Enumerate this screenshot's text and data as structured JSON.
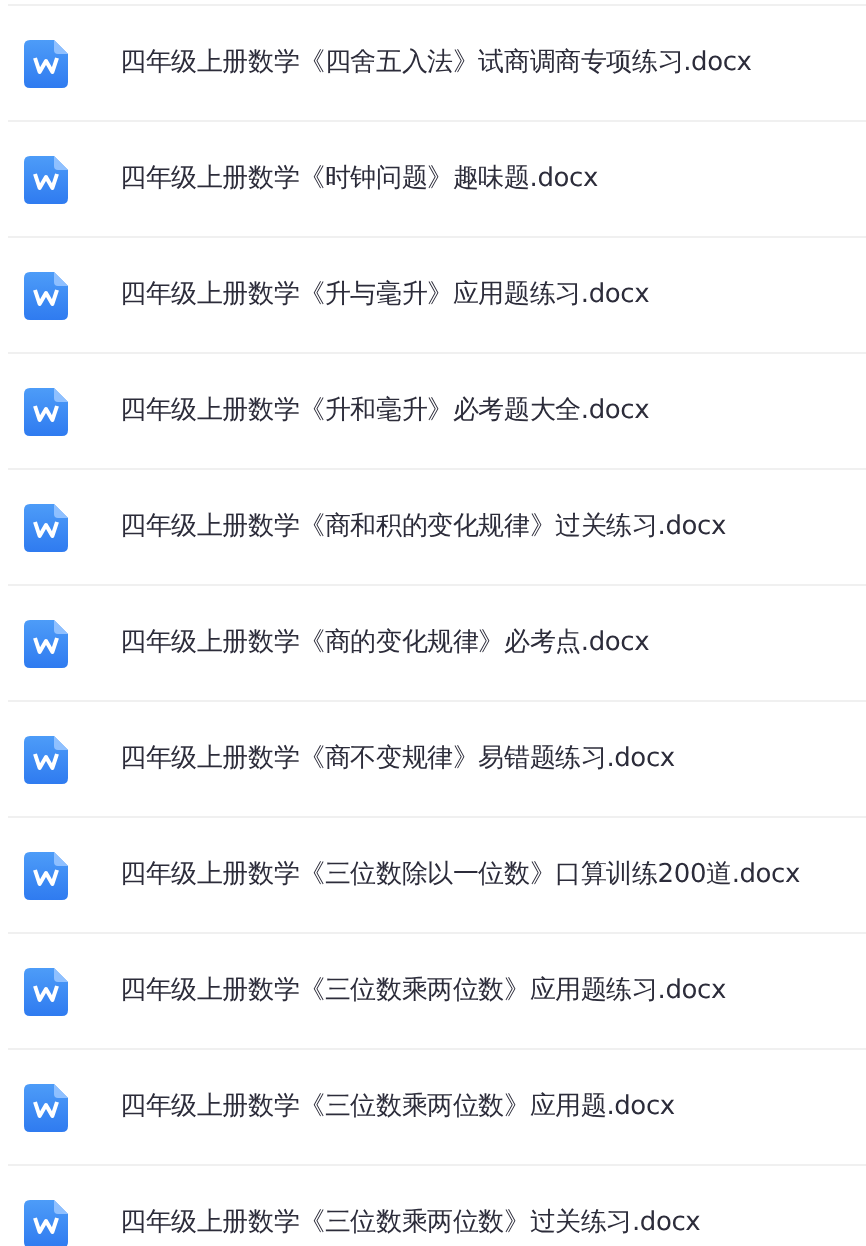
{
  "files": [
    {
      "name": "四年级上册数学《四舍五入法》试商调商专项练习.docx"
    },
    {
      "name": "四年级上册数学《时钟问题》趣味题.docx"
    },
    {
      "name": "四年级上册数学《升与毫升》应用题练习.docx"
    },
    {
      "name": "四年级上册数学《升和毫升》必考题大全.docx"
    },
    {
      "name": "四年级上册数学《商和积的变化规律》过关练习.docx"
    },
    {
      "name": "四年级上册数学《商的变化规律》必考点.docx"
    },
    {
      "name": "四年级上册数学《商不变规律》易错题练习.docx"
    },
    {
      "name": "四年级上册数学《三位数除以一位数》口算训练200道.docx"
    },
    {
      "name": "四年级上册数学《三位数乘两位数》应用题练习.docx"
    },
    {
      "name": "四年级上册数学《三位数乘两位数》应用题.docx"
    },
    {
      "name": "四年级上册数学《三位数乘两位数》过关练习.docx"
    }
  ]
}
